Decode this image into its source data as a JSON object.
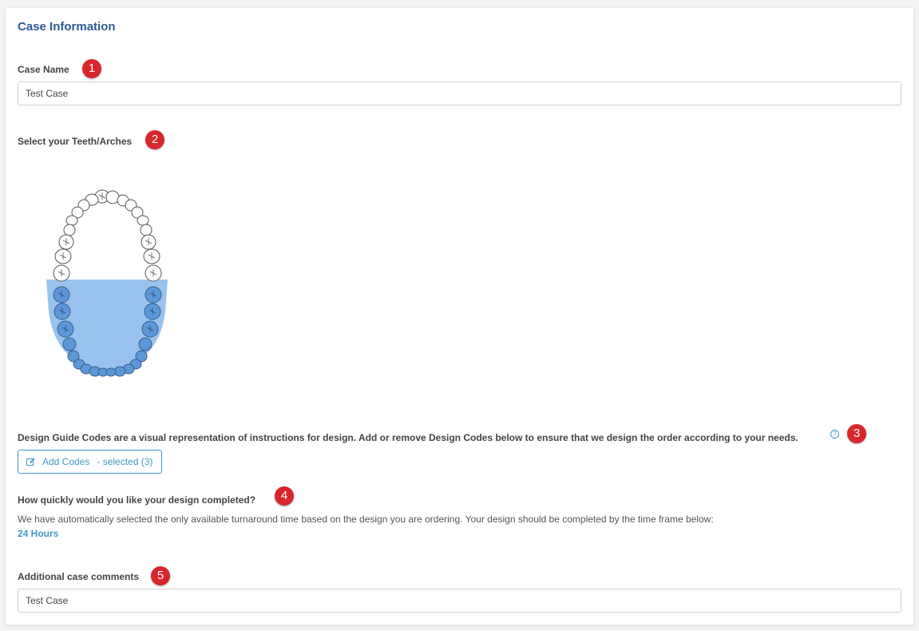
{
  "section_title": "Case Information",
  "case_name": {
    "label": "Case Name",
    "value": "Test Case"
  },
  "teeth": {
    "label": "Select your Teeth/Arches",
    "selected_arch": "lower"
  },
  "design_codes": {
    "description": "Design Guide Codes are a visual representation of instructions for design. Add or remove Design Codes below to ensure that we design the order according to your needs.",
    "button_label": "Add Codes",
    "button_suffix": "- selected (3)"
  },
  "turnaround": {
    "label": "How quickly would you like your design completed?",
    "description": "We have automatically selected the only available turnaround time based on the design you are ordering. Your design should be completed by the time frame below:",
    "value": "24 Hours"
  },
  "comments": {
    "label": "Additional case comments",
    "value": "Test Case"
  },
  "badges": [
    "1",
    "2",
    "3",
    "4",
    "5"
  ],
  "colors": {
    "accent": "#3d9ac2",
    "title": "#2b5a96",
    "badge": "#d9262c",
    "arch_fill": "#99c3ee",
    "tooth_fill": "#5c97d8"
  }
}
